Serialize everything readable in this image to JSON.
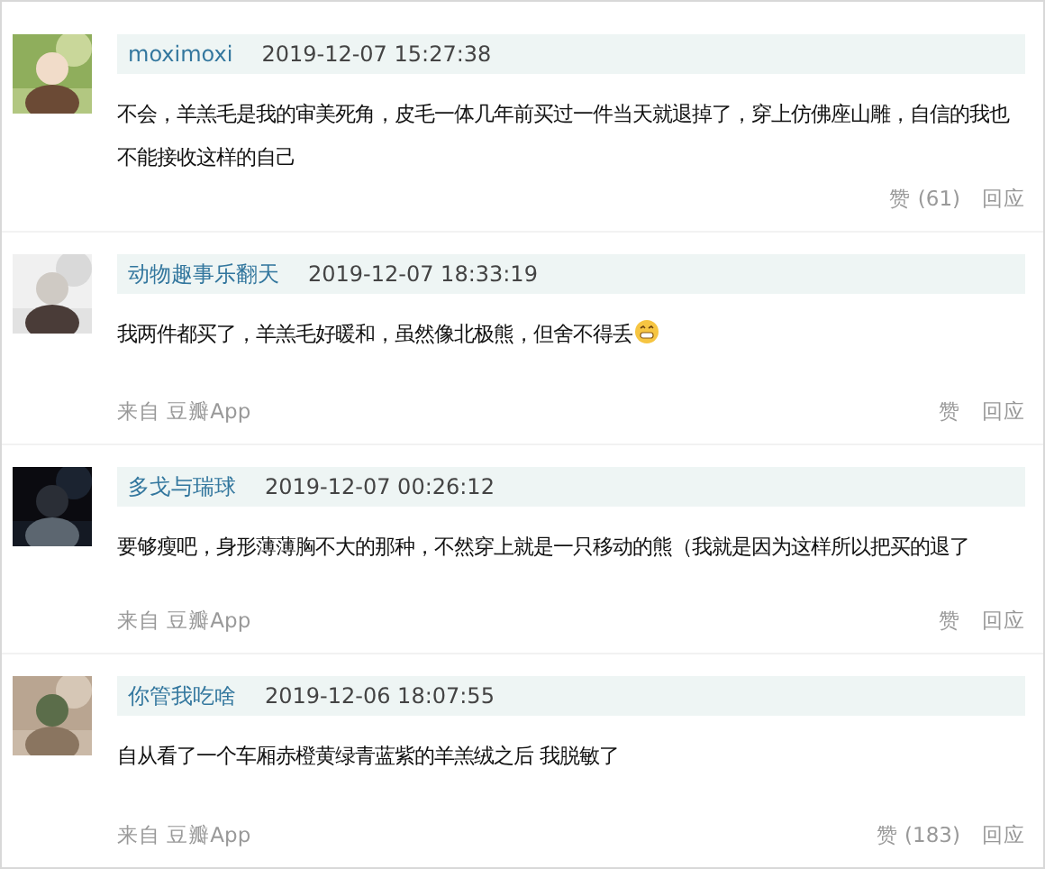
{
  "comments": [
    {
      "user": "moximoxi",
      "time": "2019-12-07 15:27:38",
      "text": "不会，羊羔毛是我的审美死角，皮毛一体几年前买过一件当天就退掉了，穿上仿佛座山雕，自信的我也不能接收这样的自己",
      "emoji": false,
      "like": "赞 (61)",
      "reply": "回应"
    },
    {
      "user": "动物趣事乐翻天",
      "time": "2019-12-07 18:33:19",
      "text": "我两件都买了，羊羔毛好暖和，虽然像北极熊，但舍不得丢",
      "emoji": true,
      "source": "来自 豆瓣App",
      "like": "赞",
      "reply": "回应"
    },
    {
      "user": "多戈与瑞球",
      "time": "2019-12-07 00:26:12",
      "text": "要够瘦吧，身形薄薄胸不大的那种，不然穿上就是一只移动的熊（我就是因为这样所以把买的退了",
      "emoji": false,
      "source": "来自 豆瓣App",
      "like": "赞",
      "reply": "回应"
    },
    {
      "user": "你管我吃啥",
      "time": "2019-12-06 18:07:55",
      "text": "自从看了一个车厢赤橙黄绿青蓝紫的羊羔绒之后 我脱敏了",
      "emoji": false,
      "source": "来自 豆瓣App",
      "like": "赞 (183)",
      "reply": "回应"
    }
  ]
}
